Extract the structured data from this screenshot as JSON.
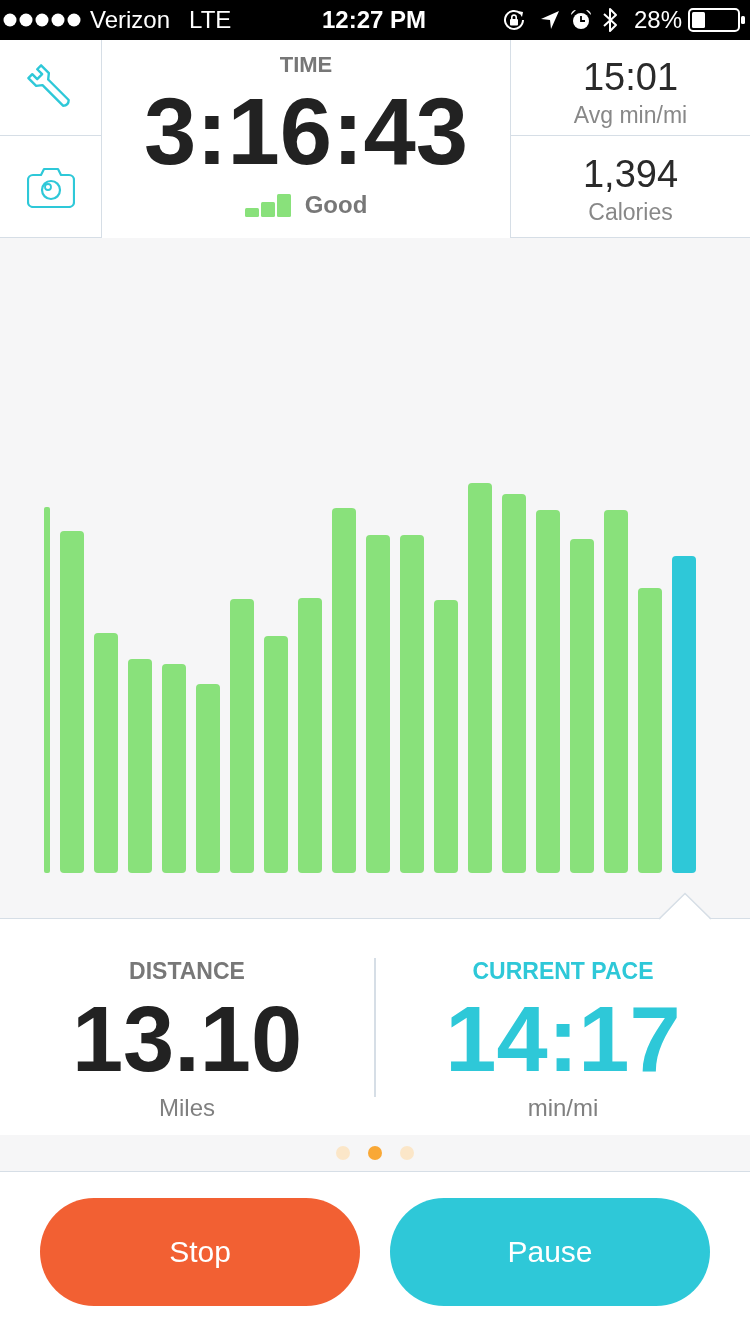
{
  "status_bar": {
    "carrier": "Verizon",
    "network": "LTE",
    "time": "12:27 PM",
    "battery": "28%"
  },
  "header": {
    "time_label": "TIME",
    "time_value": "3:16:43",
    "signal_label": "Good",
    "stats": [
      {
        "value": "15:01",
        "label": "Avg min/mi"
      },
      {
        "value": "1,394",
        "label": "Calories"
      }
    ]
  },
  "chart": {
    "bars": [
      {
        "selected": false
      },
      {
        "selected": false
      },
      {
        "selected": false
      },
      {
        "selected": false
      },
      {
        "selected": false
      },
      {
        "selected": false
      },
      {
        "selected": false
      },
      {
        "selected": false
      },
      {
        "selected": false
      },
      {
        "selected": false
      },
      {
        "selected": false
      },
      {
        "selected": false
      },
      {
        "selected": false
      },
      {
        "selected": false
      },
      {
        "selected": false
      },
      {
        "selected": false
      },
      {
        "selected": false
      },
      {
        "selected": false
      },
      {
        "selected": false
      },
      {
        "selected": true
      }
    ]
  },
  "metrics": [
    {
      "label": "DISTANCE",
      "value": "13.10",
      "unit": "Miles",
      "highlighted": false
    },
    {
      "label": "CURRENT PACE",
      "value": "14:17",
      "unit": "min/mi",
      "highlighted": true
    }
  ],
  "page_dots": [
    {
      "selected": false
    },
    {
      "selected": true
    },
    {
      "selected": false
    }
  ],
  "buttons": [
    {
      "label": "Stop",
      "kind": "stop"
    },
    {
      "label": "Pause",
      "kind": "pause"
    }
  ]
}
